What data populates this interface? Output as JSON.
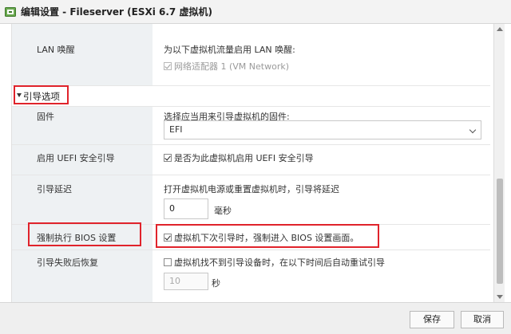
{
  "window": {
    "title": "编辑设置 - Fileserver (ESXi 6.7 虚拟机)",
    "icon": "vm-settings-icon"
  },
  "lan_wake": {
    "label": "LAN 唤醒",
    "description": "为以下虚拟机流量启用 LAN 唤醒:",
    "adapter_label": "网络适配器 1 (VM Network)",
    "adapter_checked": true
  },
  "boot_options": {
    "section_title": "引导选项",
    "firmware": {
      "label": "固件",
      "description": "选择应当用来引导虚拟机的固件:",
      "selected": "EFI"
    },
    "secure_boot": {
      "label": "启用 UEFI 安全引导",
      "checkbox_label": "是否为此虚拟机启用 UEFI 安全引导",
      "checked": true
    },
    "boot_delay": {
      "label": "引导延迟",
      "description": "打开虚拟机电源或重置虚拟机时，引导将延迟",
      "value": "0",
      "unit": "毫秒"
    },
    "force_bios": {
      "label": "强制执行 BIOS 设置",
      "checkbox_label": "虚拟机下次引导时，强制进入 BIOS 设置画面。",
      "checked": true
    },
    "failed_boot_recovery": {
      "label": "引导失败后恢复",
      "checkbox_label": "虚拟机找不到引导设备时，在以下时间后自动重试引导",
      "checked": false,
      "value": "10",
      "unit": "秒"
    }
  },
  "footer": {
    "save_label": "保存",
    "cancel_label": "取消"
  },
  "colors": {
    "highlight": "#e0232b",
    "label_column": "#eef1f3"
  }
}
